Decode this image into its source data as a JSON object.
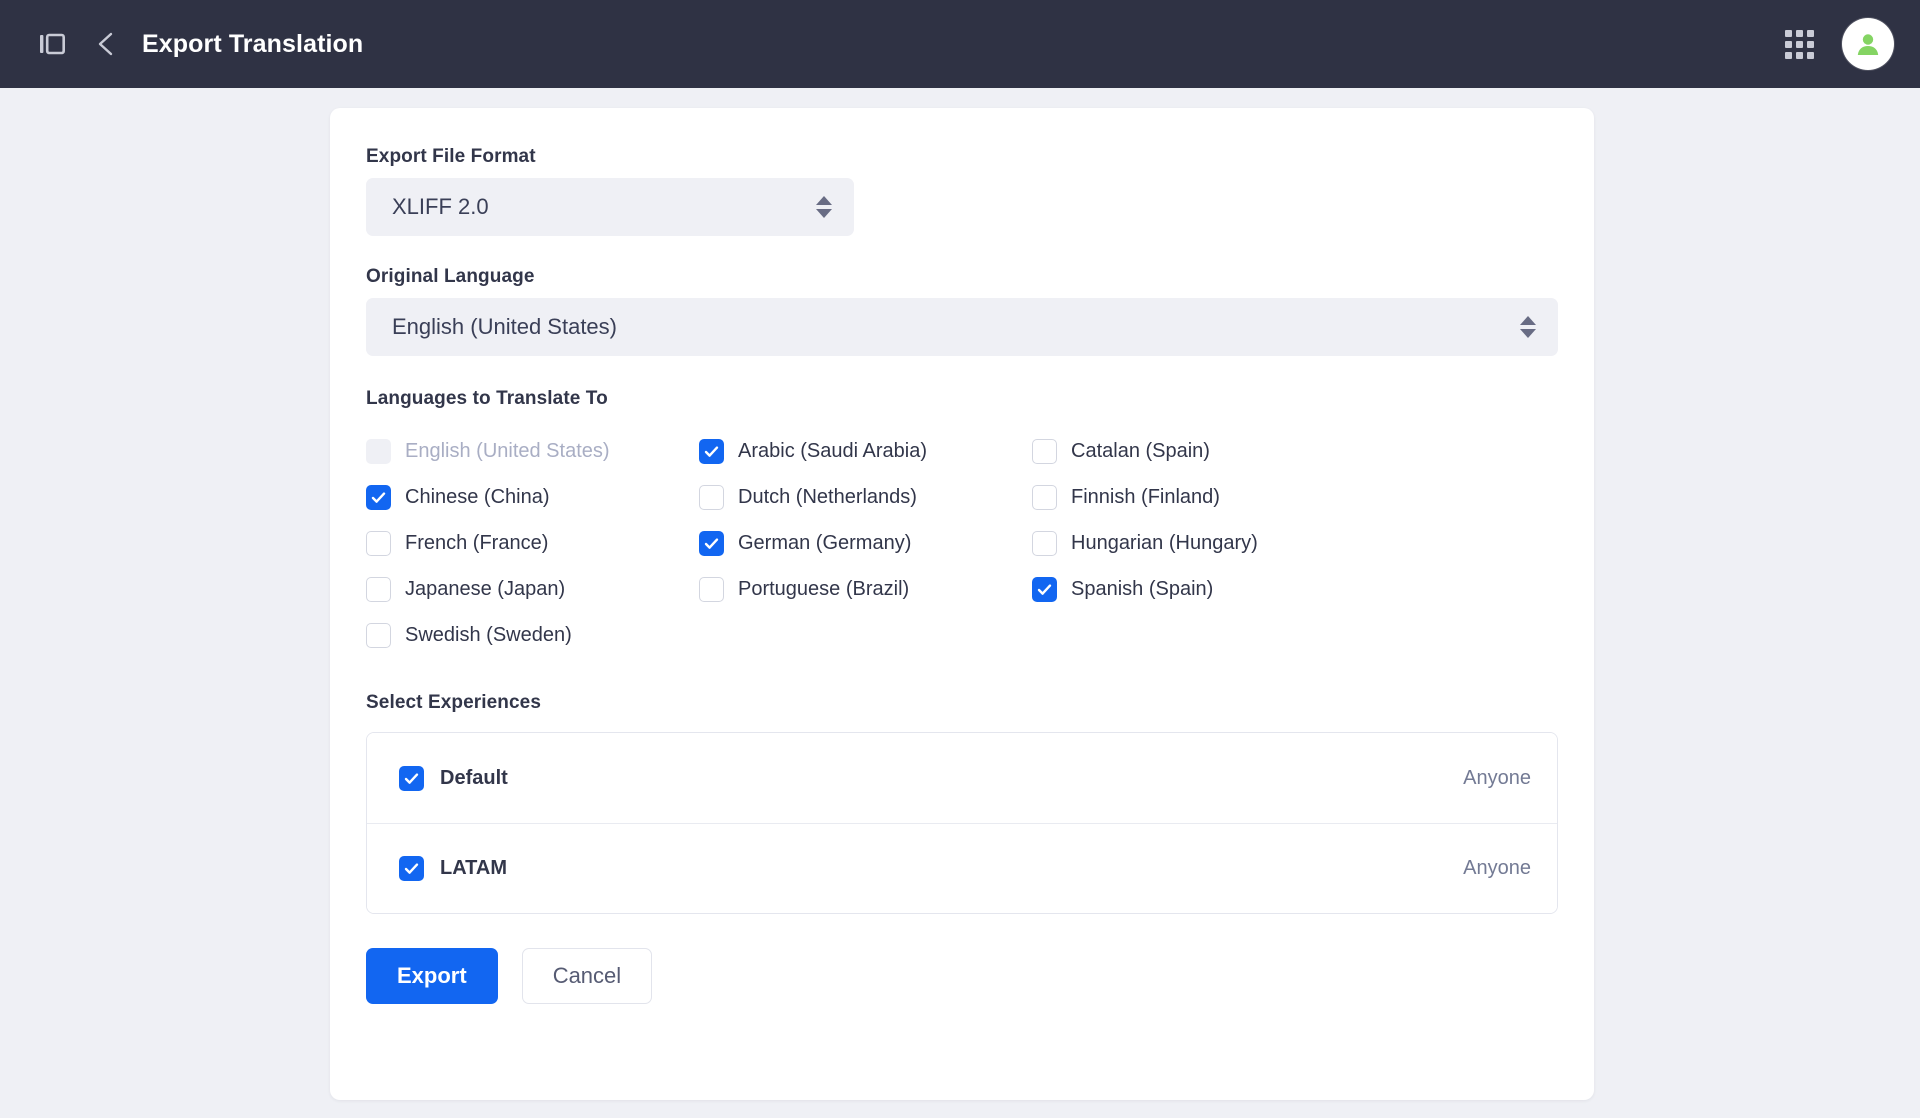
{
  "header": {
    "title": "Export Translation",
    "panel_toggle_icon": "sidebar-panel-icon",
    "back_icon": "chevron-left-icon",
    "apps_icon": "grid-apps-icon",
    "avatar_icon": "user-avatar-icon"
  },
  "theme": {
    "header_bg": "#2f3244",
    "page_bg": "#eff0f5",
    "card_bg": "#ffffff",
    "accent": "#1266f1",
    "text": "#32364a",
    "muted_text": "#737a94",
    "disabled_text": "#a9aec4"
  },
  "form": {
    "export_format": {
      "label": "Export File Format",
      "value": "XLIFF 2.0"
    },
    "original_language": {
      "label": "Original Language",
      "value": "English (United States)"
    },
    "languages": {
      "label": "Languages to Translate To",
      "items": [
        {
          "name": "English (United States)",
          "checked": false,
          "disabled": true
        },
        {
          "name": "Arabic (Saudi Arabia)",
          "checked": true,
          "disabled": false
        },
        {
          "name": "Catalan (Spain)",
          "checked": false,
          "disabled": false
        },
        {
          "name": "Chinese (China)",
          "checked": true,
          "disabled": false
        },
        {
          "name": "Dutch (Netherlands)",
          "checked": false,
          "disabled": false
        },
        {
          "name": "Finnish (Finland)",
          "checked": false,
          "disabled": false
        },
        {
          "name": "French (France)",
          "checked": false,
          "disabled": false
        },
        {
          "name": "German (Germany)",
          "checked": true,
          "disabled": false
        },
        {
          "name": "Hungarian (Hungary)",
          "checked": false,
          "disabled": false
        },
        {
          "name": "Japanese (Japan)",
          "checked": false,
          "disabled": false
        },
        {
          "name": "Portuguese (Brazil)",
          "checked": false,
          "disabled": false
        },
        {
          "name": "Spanish (Spain)",
          "checked": true,
          "disabled": false
        },
        {
          "name": "Swedish (Sweden)",
          "checked": false,
          "disabled": false
        }
      ]
    },
    "experiences": {
      "label": "Select Experiences",
      "rows": [
        {
          "name": "Default",
          "access": "Anyone",
          "checked": true
        },
        {
          "name": "LATAM",
          "access": "Anyone",
          "checked": true
        }
      ]
    },
    "actions": {
      "submit_label": "Export",
      "cancel_label": "Cancel"
    }
  }
}
